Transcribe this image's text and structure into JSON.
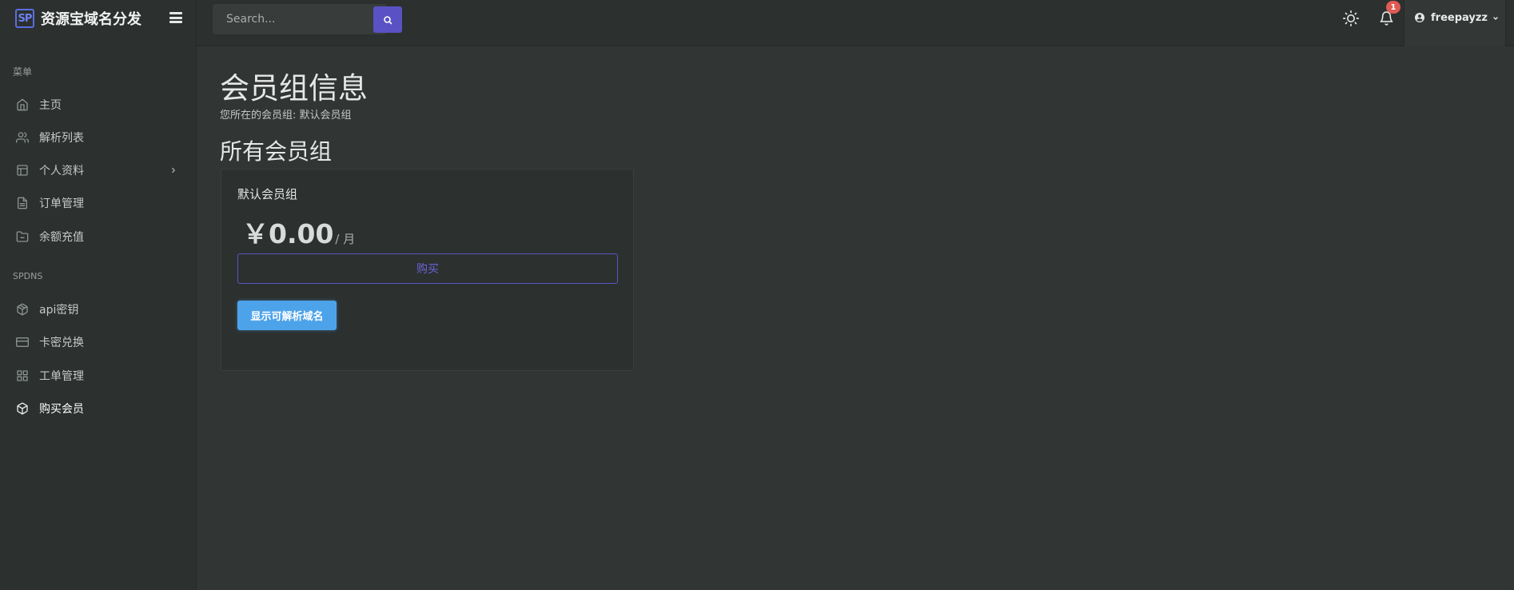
{
  "brand": {
    "logo_text": "SP",
    "name": "资源宝域名分发"
  },
  "sidebar": {
    "section_menu": "菜单",
    "menu_items": [
      {
        "label": "主页",
        "icon": "home-icon"
      },
      {
        "label": "解析列表",
        "icon": "users-icon"
      },
      {
        "label": "个人资料",
        "icon": "layout-icon",
        "has_submenu": true
      },
      {
        "label": "订单管理",
        "icon": "file-text-icon"
      },
      {
        "label": "余额充值",
        "icon": "folder-icon"
      }
    ],
    "section_spdns": "SPDNS",
    "spdns_items": [
      {
        "label": "api密钥",
        "icon": "package-icon"
      },
      {
        "label": "卡密兑换",
        "icon": "credit-card-icon"
      },
      {
        "label": "工单管理",
        "icon": "grid-icon"
      },
      {
        "label": "购买会员",
        "icon": "box-icon",
        "active": true
      }
    ]
  },
  "topbar": {
    "search_placeholder": "Search...",
    "notification_count": "1",
    "username": "freepayzz"
  },
  "main": {
    "title": "会员组信息",
    "subtitle": "您所在的会员组: 默认会员组",
    "section_title": "所有会员组",
    "groups": [
      {
        "name": "默认会员组",
        "price": "￥0.00",
        "period": "/ 月",
        "buy_label": "购买",
        "show_domains_label": "显示可解析域名"
      }
    ]
  },
  "colors": {
    "background": "#313534",
    "panel": "#2c302f",
    "accent_purple": "#5a52c4",
    "accent_blue": "#4da3ea",
    "badge_red": "#e05a54"
  }
}
